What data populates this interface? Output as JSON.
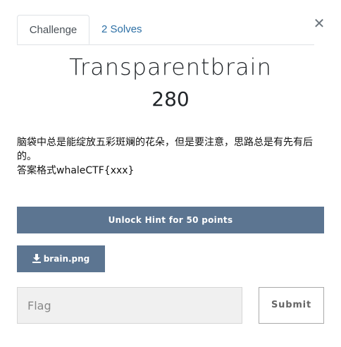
{
  "tabs": [
    {
      "label": "Challenge",
      "active": true
    },
    {
      "label": "2 Solves",
      "active": false
    }
  ],
  "close_icon": "close-icon",
  "challenge": {
    "name": "Transparentbrain",
    "points": "280",
    "description_lines": [
      "脑袋中总是能绽放五彩斑斓的花朵，但是要注意，思路总是有先有后的。",
      "答案格式whaleCTF{xxx}"
    ]
  },
  "hint": {
    "label": "Unlock Hint for 50 points"
  },
  "file": {
    "label": "brain.png",
    "icon": "download-icon"
  },
  "flag": {
    "placeholder": "Flag",
    "value": ""
  },
  "submit": {
    "label": "Submit"
  },
  "colors": {
    "button_bg": "#5c7591",
    "link": "#2c6fa5"
  }
}
